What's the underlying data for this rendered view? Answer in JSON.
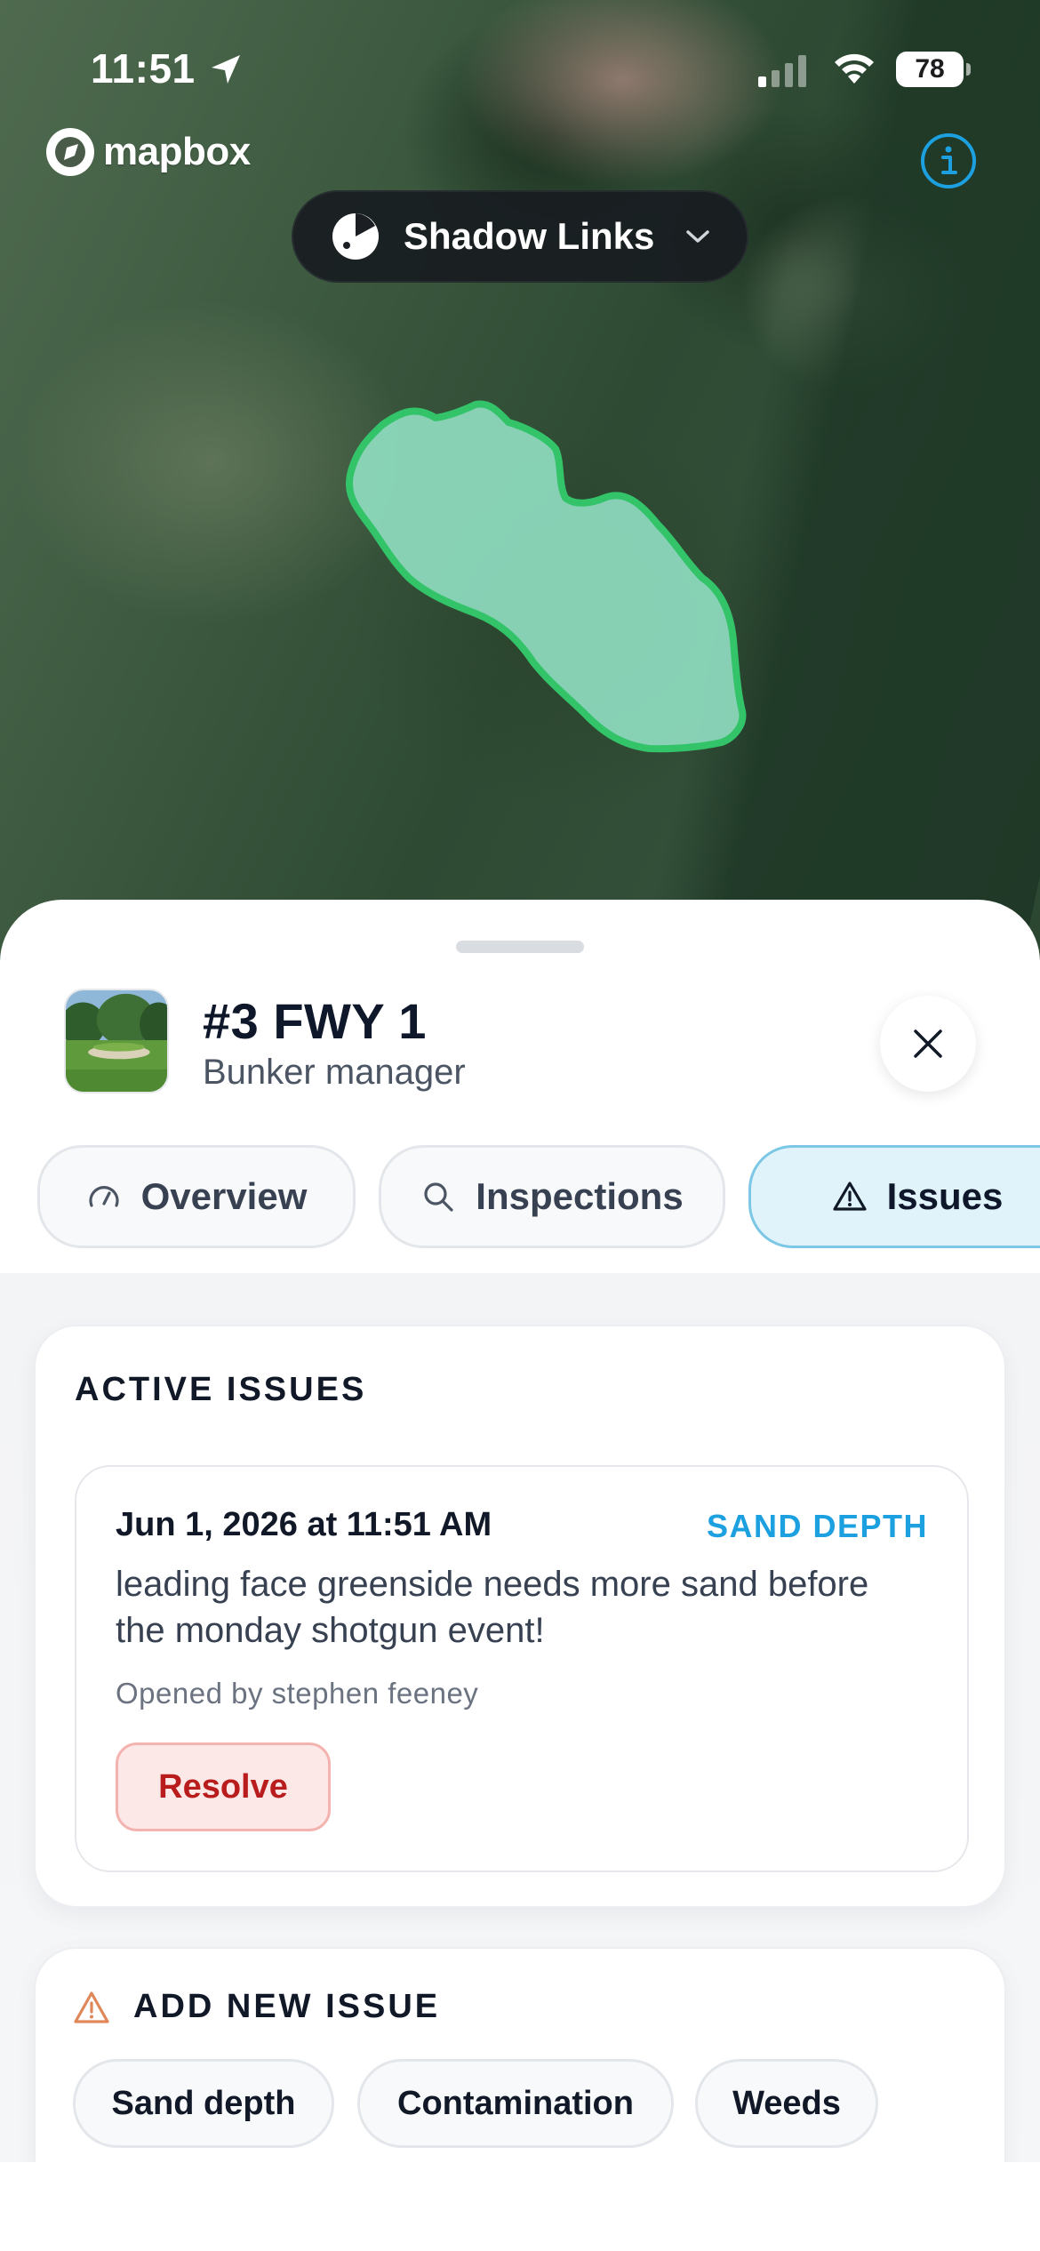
{
  "status_bar": {
    "time": "11:51",
    "battery": "78"
  },
  "map": {
    "attribution": "mapbox",
    "polygon_color": "#33c46a",
    "polygon_fill": "#8fdcc0"
  },
  "course_picker": {
    "name": "Shadow Links"
  },
  "header": {
    "title": "#3 FWY 1",
    "subtitle": "Bunker manager"
  },
  "tabs": [
    {
      "label": "Overview",
      "icon": "gauge-icon",
      "active": false
    },
    {
      "label": "Inspections",
      "icon": "search-icon",
      "active": false
    },
    {
      "label": "Issues",
      "icon": "warning-icon",
      "active": true
    }
  ],
  "active_issues": {
    "title": "ACTIVE ISSUES",
    "items": [
      {
        "date": "Jun 1, 2026 at 11:51 AM",
        "type": "SAND DEPTH",
        "description": "leading face greenside needs more sand before the monday shotgun event!",
        "opened_by": "Opened by stephen feeney",
        "action": "Resolve"
      }
    ]
  },
  "add_issue": {
    "title": "ADD NEW ISSUE",
    "options": [
      "Sand depth",
      "Contamination",
      "Weeds"
    ]
  },
  "colors": {
    "accent": "#1ca0e0",
    "active_tab_bg": "#e0f3fb",
    "resolve_bg": "#fde8e8",
    "resolve_text": "#b91c1c",
    "warning": "#e0875a"
  }
}
